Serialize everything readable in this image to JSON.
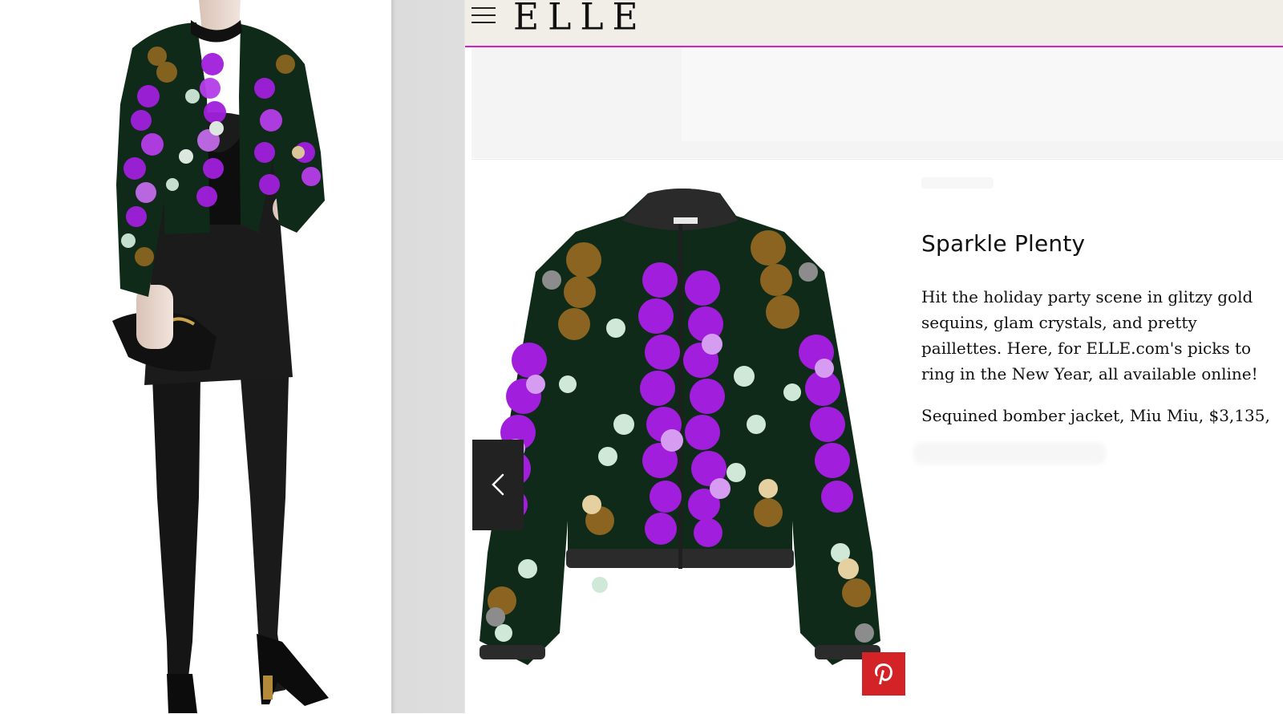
{
  "header": {
    "logo_text": "ELLE",
    "accent_color": "#d61ec9",
    "menu_icon": "hamburger-menu-icon"
  },
  "slide": {
    "title": "Sparkle Plenty",
    "description": "Hit the holiday party scene in glitzy gold sequins, glam crystals, and pretty paillettes. Here, for ELLE.com's picks to ring in the New Year, all available online!",
    "product_credit": "Sequined bomber jacket, Miu Miu, $3,135,",
    "prev_icon": "chevron-left-icon",
    "pin_icon": "pinterest-icon",
    "pin_color": "#d42327"
  },
  "colors": {
    "sequin_purple": "#a11fdc",
    "sequin_green": "#0f2a18",
    "sequin_gold": "#8a6420",
    "sequin_mint": "#cfe8d8"
  }
}
